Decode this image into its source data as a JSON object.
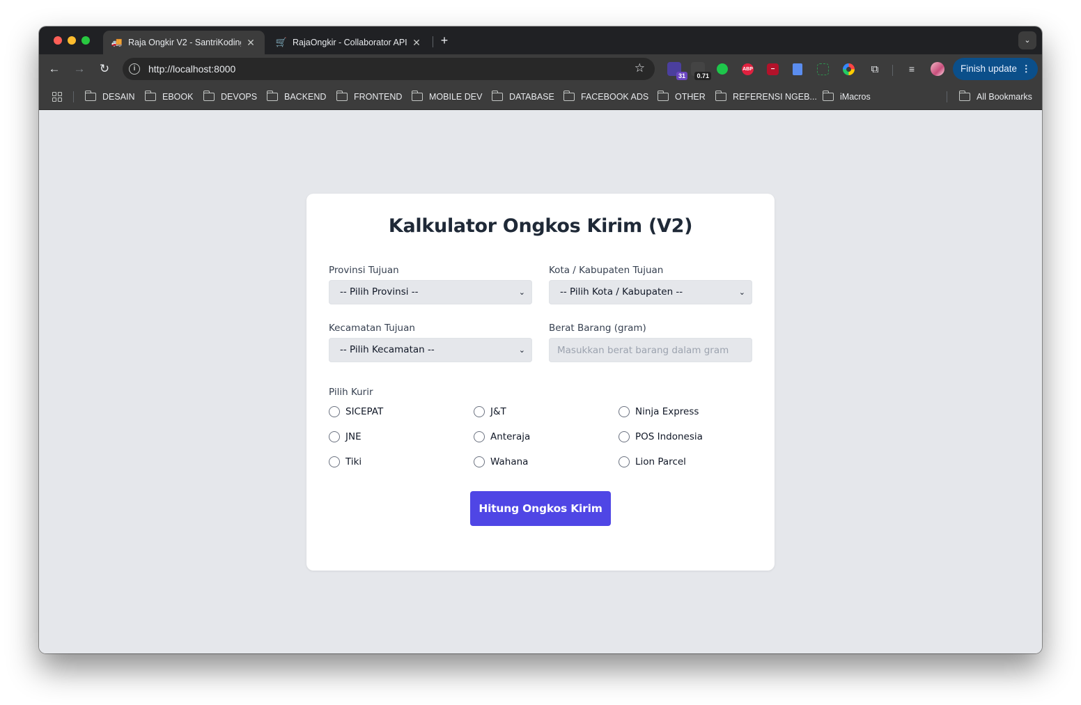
{
  "browser": {
    "tabs": [
      {
        "title": "Raja Ongkir V2 - SantriKoding",
        "active": true
      },
      {
        "title": "RajaOngkir - Collaborator API",
        "active": false
      }
    ],
    "url": "http://localhost:8000",
    "extensions": [
      {
        "icon": "calendar-icon",
        "badge": "31"
      },
      {
        "icon": "speed-icon",
        "badge": "0.71"
      },
      {
        "icon": "green-dot-icon"
      },
      {
        "icon": "adblock-icon",
        "label": "ABP"
      },
      {
        "icon": "shield-block-icon"
      },
      {
        "icon": "doc-copy-icon"
      },
      {
        "icon": "screenshot-icon"
      },
      {
        "icon": "color-picker-icon"
      },
      {
        "icon": "puzzle-extensions-icon"
      }
    ],
    "finish_update_label": "Finish update",
    "bookmarks": [
      "DESAIN",
      "EBOOK",
      "DEVOPS",
      "BACKEND",
      "FRONTEND",
      "MOBILE DEV",
      "DATABASE",
      "FACEBOOK ADS",
      "OTHER",
      "REFERENSI NGEB...",
      "iMacros"
    ],
    "all_bookmarks_label": "All Bookmarks"
  },
  "form": {
    "title": "Kalkulator Ongkos Kirim (V2)",
    "provinsi_label": "Provinsi Tujuan",
    "provinsi_value": "-- Pilih Provinsi --",
    "kota_label": "Kota / Kabupaten Tujuan",
    "kota_value": "-- Pilih Kota / Kabupaten --",
    "kecamatan_label": "Kecamatan Tujuan",
    "kecamatan_value": "-- Pilih Kecamatan --",
    "berat_label": "Berat Barang (gram)",
    "berat_placeholder": "Masukkan berat barang dalam gram",
    "kurir_label": "Pilih Kurir",
    "couriers": [
      "SICEPAT",
      "J&T",
      "Ninja Express",
      "JNE",
      "Anteraja",
      "POS Indonesia",
      "Tiki",
      "Wahana",
      "Lion Parcel"
    ],
    "submit_label": "Hitung Ongkos Kirim"
  },
  "colors": {
    "primary_button": "#4f46e5",
    "page_background": "#e5e7eb",
    "finish_update_bg": "#0b4f8a"
  }
}
